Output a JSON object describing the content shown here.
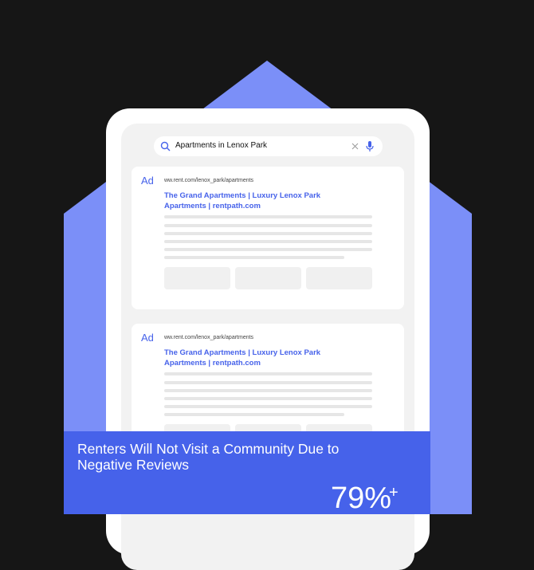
{
  "colors": {
    "background": "#161616",
    "envelope": "#7b8ff8",
    "accent": "#4662ea"
  },
  "search": {
    "query": "Apartments in Lenox Park",
    "icons": [
      "search-icon",
      "clear-icon",
      "microphone-icon"
    ]
  },
  "results": [
    {
      "badge": "Ad",
      "url": "ww.rent.com/lenox_park/apartments",
      "title": "The Grand Apartments | Luxury Lenox Park Apartments | rentpath.com"
    },
    {
      "badge": "Ad",
      "url": "ww.rent.com/lenox_park/apartments",
      "title": "The Grand Apartments | Luxury Lenox Park Apartments | rentpath.com"
    }
  ],
  "banner": {
    "heading": "Renters Will Not Visit a Community Due to Negative Reviews",
    "stat": "79%",
    "stat_suffix": "+"
  }
}
